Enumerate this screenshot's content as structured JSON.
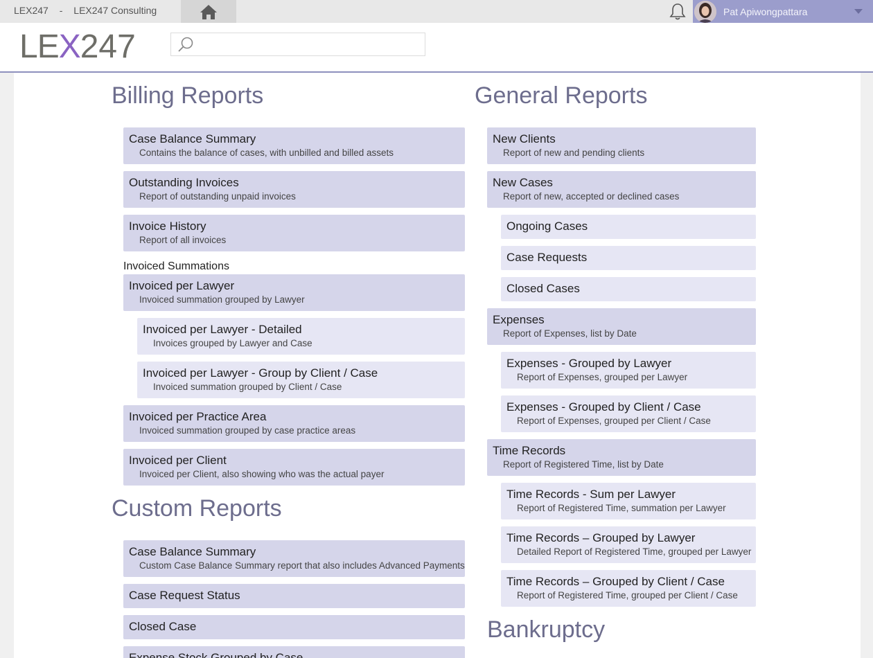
{
  "topbar": {
    "app_short": "LEX247",
    "separator": "-",
    "company": "LEX247 Consulting",
    "user_name": "Pat Apiwongpattara",
    "accent": "#9b9dcc"
  },
  "header": {
    "logo_le": "LE",
    "logo_x": "X",
    "logo_num": "247",
    "search_placeholder": "",
    "search_value": ""
  },
  "billing": {
    "title": "Billing Reports",
    "group_label": "Invoiced Summations",
    "cards": [
      {
        "title": "Case Balance Summary",
        "desc": "Contains the balance of cases, with unbilled and billed assets"
      },
      {
        "title": "Outstanding Invoices",
        "desc": "Report of outstanding unpaid invoices"
      },
      {
        "title": "Invoice History",
        "desc": "Report of all invoices"
      },
      {
        "title": "Invoiced per Lawyer",
        "desc": "Invoiced summation grouped by Lawyer"
      },
      {
        "title": "Invoiced per Lawyer - Detailed",
        "desc": "Invoices grouped by Lawyer and Case"
      },
      {
        "title": "Invoiced per Lawyer - Group by Client / Case",
        "desc": "Invoiced summation grouped by Client / Case"
      },
      {
        "title": "Invoiced per Practice Area",
        "desc": "Invoiced summation grouped by case practice areas"
      },
      {
        "title": "Invoiced per Client",
        "desc": "Invoiced per Client, also showing who was the actual payer"
      }
    ]
  },
  "custom": {
    "title": "Custom Reports",
    "cards": [
      {
        "title": "Case Balance Summary",
        "desc": "Custom Case Balance Summary report that also includes Advanced Payments"
      },
      {
        "title": "Case Request Status"
      },
      {
        "title": "Closed Case"
      },
      {
        "title": "Expense Stock Grouped by Case"
      }
    ]
  },
  "general": {
    "title": "General Reports",
    "cards": [
      {
        "title": "New Clients",
        "desc": "Report of new and pending clients"
      },
      {
        "title": "New Cases",
        "desc": "Report of new, accepted or declined cases"
      },
      {
        "title": "Ongoing Cases"
      },
      {
        "title": "Case Requests"
      },
      {
        "title": "Closed Cases"
      },
      {
        "title": "Expenses",
        "desc": "Report of Expenses, list by Date"
      },
      {
        "title": "Expenses - Grouped by Lawyer",
        "desc": "Report of Expenses, grouped per Lawyer"
      },
      {
        "title": "Expenses - Grouped by Client / Case",
        "desc": "Report of Expenses, grouped per Client / Case"
      },
      {
        "title": "Time Records",
        "desc": "Report of Registered Time, list by Date"
      },
      {
        "title": "Time Records - Sum per Lawyer",
        "desc": "Report of Registered Time, summation per Lawyer"
      },
      {
        "title": "Time Records – Grouped by Lawyer",
        "desc": "Detailed Report of Registered Time, grouped per Lawyer"
      },
      {
        "title": "Time Records – Grouped by Client / Case",
        "desc": "Report of Registered Time, grouped per Client / Case"
      }
    ]
  },
  "bankruptcy": {
    "title": "Bankruptcy"
  }
}
